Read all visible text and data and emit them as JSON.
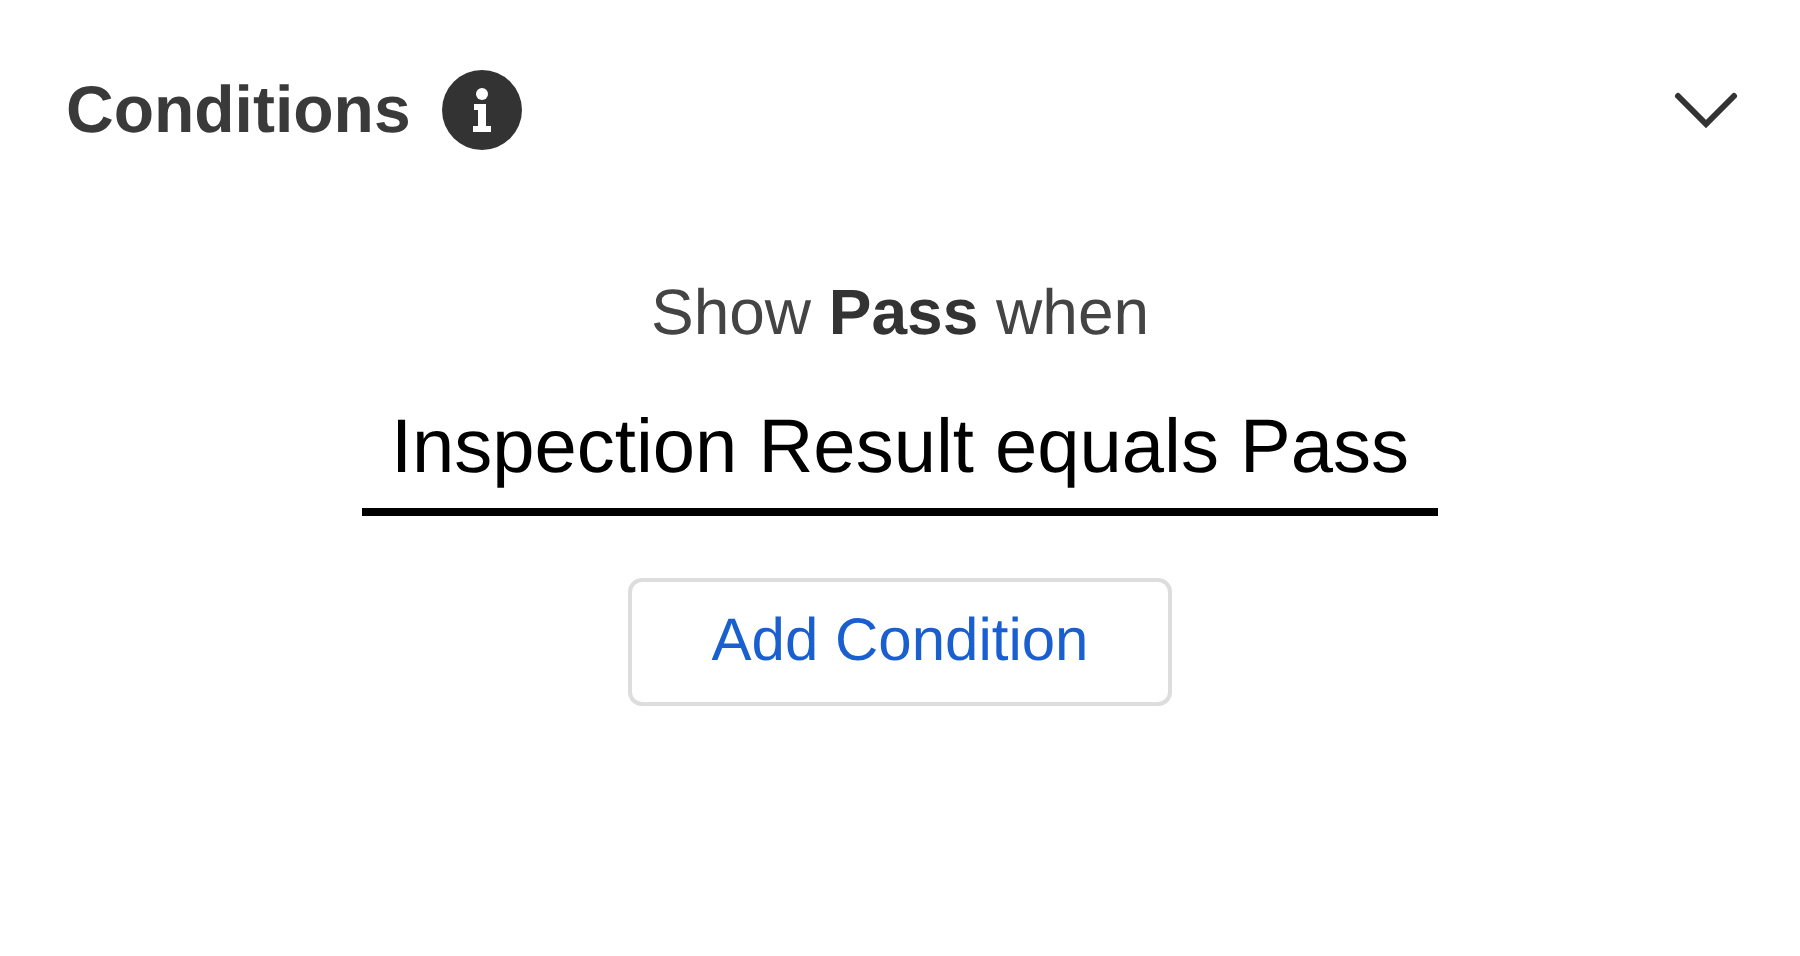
{
  "section": {
    "title": "Conditions",
    "expanded": true
  },
  "rule": {
    "heading": "Show **Pass** when",
    "conditions": [
      "Inspection Result equals Pass"
    ]
  },
  "buttons": [
    "Add Condition"
  ]
}
